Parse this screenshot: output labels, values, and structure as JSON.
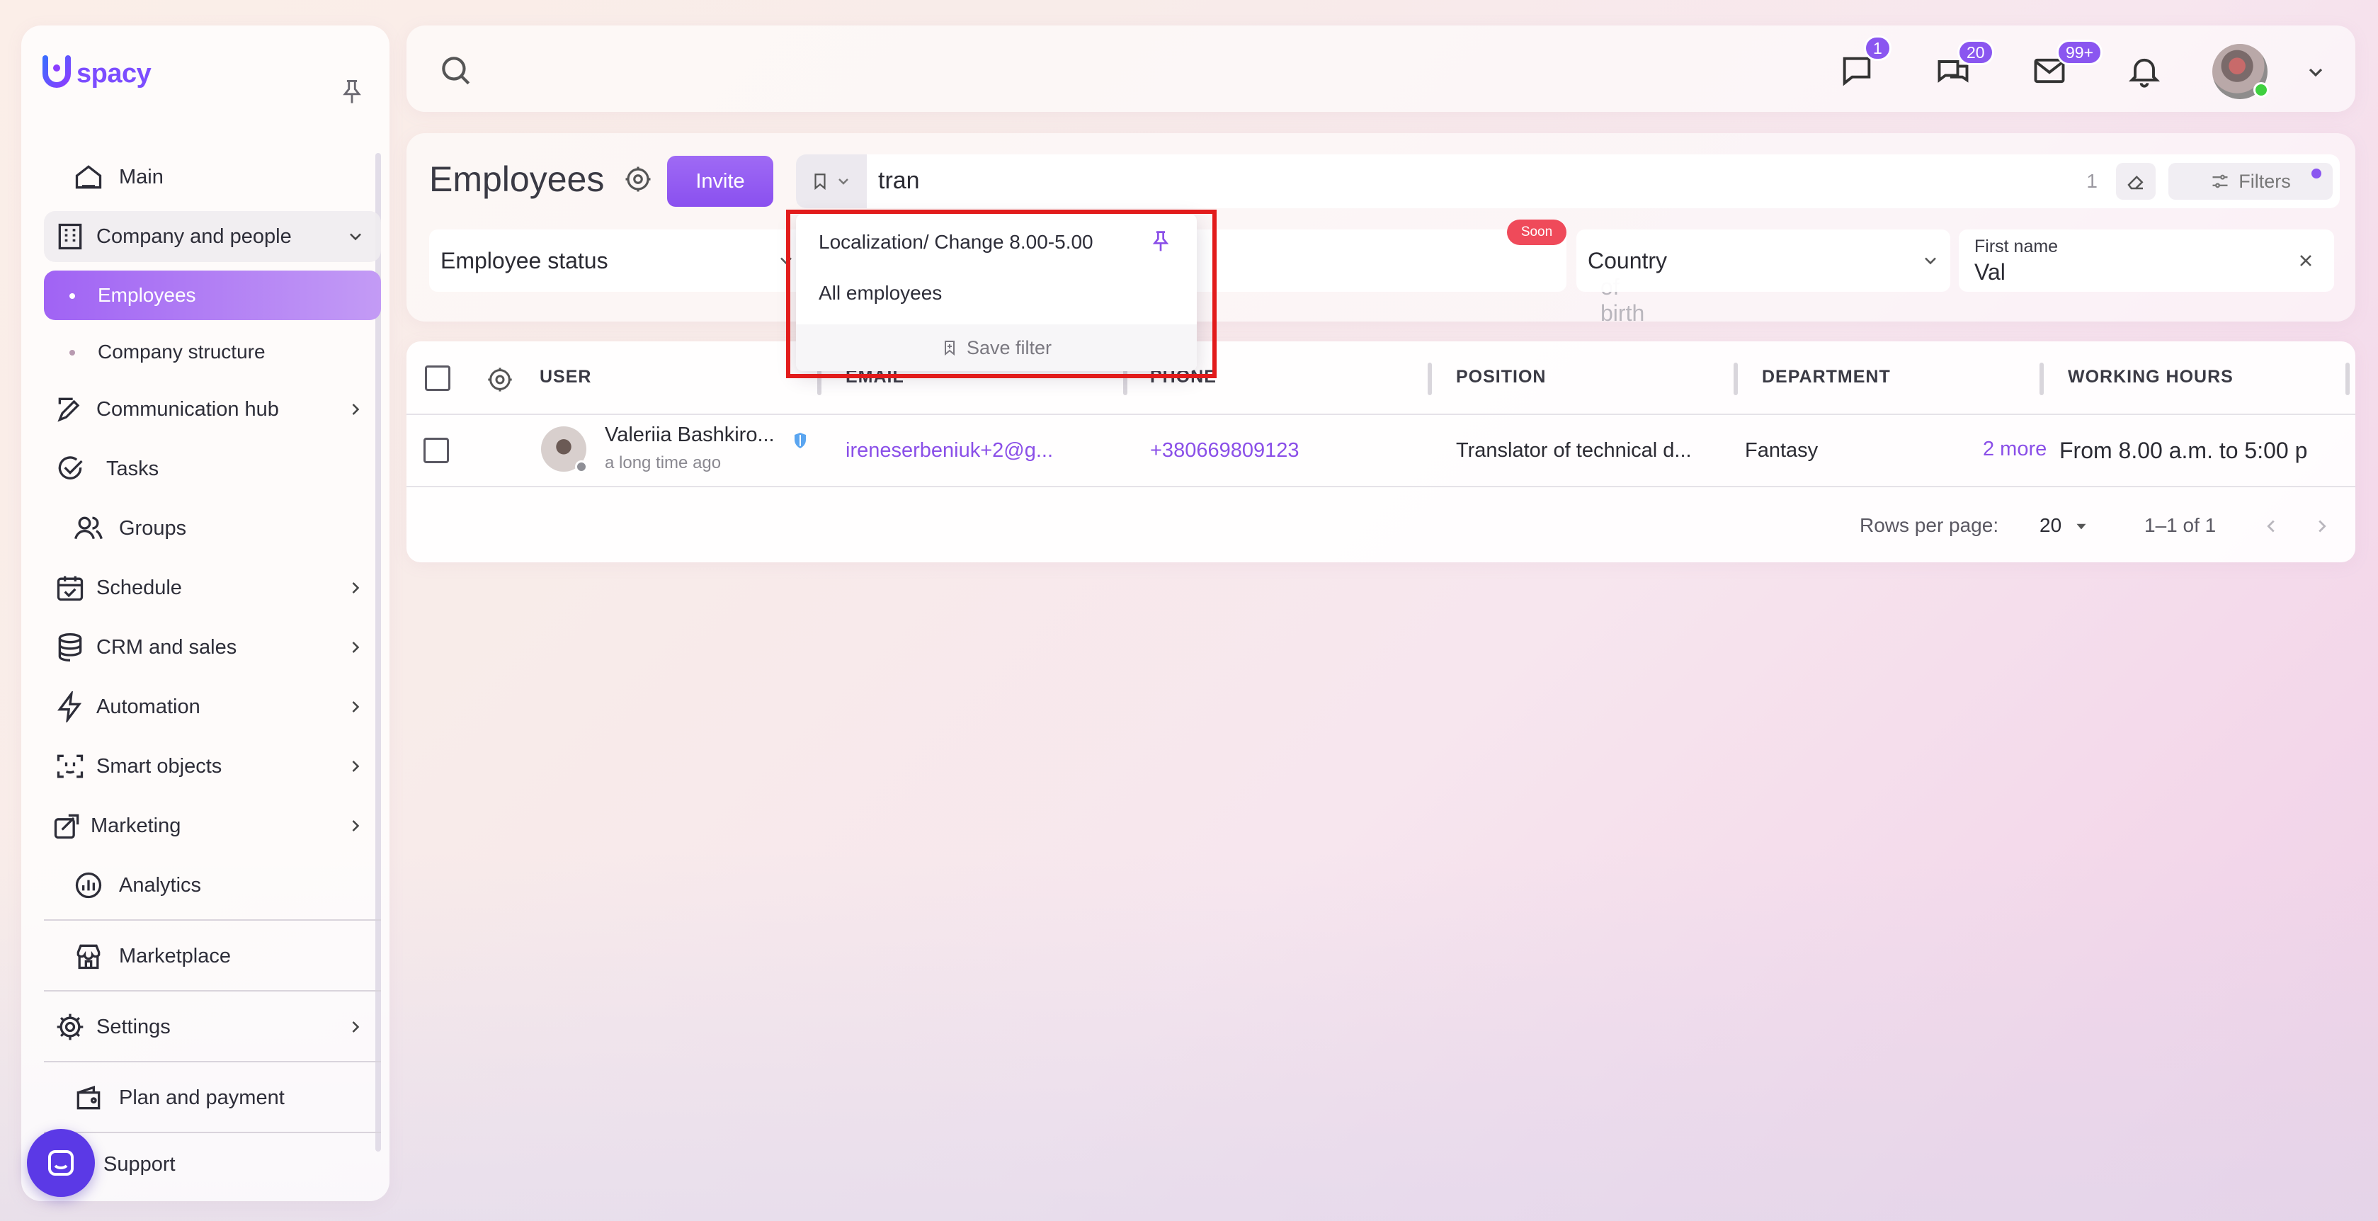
{
  "app": {
    "logo_text": "spacy",
    "brand_color": "#8a56f0"
  },
  "sidebar": {
    "items": [
      {
        "label": "Main",
        "icon": "home-icon"
      },
      {
        "label": "Company and people",
        "icon": "building-icon"
      },
      {
        "label": "Communication hub",
        "icon": "edit-chat-icon"
      },
      {
        "label": "Tasks",
        "icon": "check-circle-icon"
      },
      {
        "label": "Groups",
        "icon": "users-icon"
      },
      {
        "label": "Schedule",
        "icon": "calendar-icon"
      },
      {
        "label": "CRM and sales",
        "icon": "database-icon"
      },
      {
        "label": "Automation",
        "icon": "lightning-icon"
      },
      {
        "label": "Smart objects",
        "icon": "scan-face-icon"
      },
      {
        "label": "Marketing",
        "icon": "marketing-icon"
      },
      {
        "label": "Analytics",
        "icon": "chart-circle-icon"
      },
      {
        "label": "Marketplace",
        "icon": "store-icon"
      },
      {
        "label": "Settings",
        "icon": "gear-icon"
      },
      {
        "label": "Plan and payment",
        "icon": "wallet-icon"
      },
      {
        "label": "Support",
        "icon": "chat-support-icon"
      }
    ],
    "sub_items": [
      {
        "label": "Employees"
      },
      {
        "label": "Company structure"
      }
    ]
  },
  "topbar": {
    "badges": {
      "messages": "1",
      "chats": "20",
      "mail": "99+"
    }
  },
  "header": {
    "title": "Employees",
    "invite_label": "Invite",
    "search_value": "tran",
    "result_count": "1",
    "filters_label": "Filters",
    "filters": {
      "employee_status": "Employee status",
      "date_of_birth_placeholder": "Date of birth",
      "soon_badge": "Soon",
      "country": "Country",
      "first_name_label": "First name",
      "first_name_value": "Val"
    }
  },
  "preset_dropdown": {
    "items": [
      {
        "label": "Localization/ Change 8.00-5.00",
        "pinned": true
      },
      {
        "label": "All employees",
        "pinned": false
      }
    ],
    "save_label": "Save filter"
  },
  "table": {
    "columns": [
      "USER",
      "EMAIL",
      "PHONE",
      "POSITION",
      "DEPARTMENT",
      "WORKING HOURS"
    ],
    "rows": [
      {
        "name": "Valeriia Bashkiro...",
        "last_seen": "a long time ago",
        "email": "ireneserbeniuk+2@g...",
        "phone": "+380669809123",
        "position": "Translator of technical d...",
        "department": "Fantasy",
        "department_more": "2 more",
        "working_hours": "From 8.00 a.m. to 5:00 p"
      }
    ],
    "footer": {
      "rows_per_page_label": "Rows per page:",
      "rows_per_page_value": "20",
      "range": "1–1 of 1"
    }
  }
}
